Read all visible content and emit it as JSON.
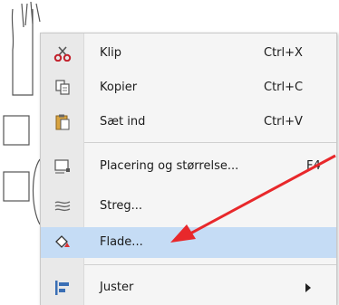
{
  "menu": {
    "items": [
      {
        "label": "Klip",
        "shortcut": "Ctrl+X",
        "icon": "scissors-icon"
      },
      {
        "label": "Kopier",
        "shortcut": "Ctrl+C",
        "icon": "copy-icon"
      },
      {
        "label": "Sæt ind",
        "shortcut": "Ctrl+V",
        "icon": "paste-icon"
      },
      {
        "label": "Placering og størrelse...",
        "shortcut": "F4",
        "icon": "position-size-icon"
      },
      {
        "label": "Streg...",
        "shortcut": "",
        "icon": "line-icon"
      },
      {
        "label": "Flade...",
        "shortcut": "",
        "icon": "area-fill-icon"
      },
      {
        "label": "Juster",
        "shortcut": "",
        "icon": "align-icon"
      }
    ]
  },
  "colors": {
    "highlight": "#c5dcf5",
    "annotation_arrow": "#e8282b",
    "scissors": "#c2202b",
    "align_icon": "#3a6fb5"
  }
}
